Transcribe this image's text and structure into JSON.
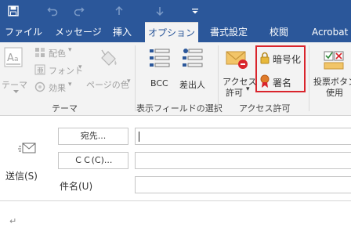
{
  "quick_access": {
    "save_icon": "save-icon",
    "undo_icon": "undo-icon",
    "redo_icon": "redo-icon",
    "up_icon": "up-arrow-icon",
    "down_icon": "down-arrow-icon",
    "customize_icon": "customize-icon"
  },
  "tabs": [
    {
      "label": "ファイル"
    },
    {
      "label": "メッセージ"
    },
    {
      "label": "挿入"
    },
    {
      "label": "オプション"
    },
    {
      "label": "書式設定"
    },
    {
      "label": "校閲"
    },
    {
      "label": "Acrobat"
    }
  ],
  "active_tab": "オプション",
  "ribbon": {
    "theme_group": {
      "theme_label": "テーマ",
      "colors_label": "配色",
      "fonts_label": "フォント",
      "effects_label": "効果",
      "page_color_label": "ページの色",
      "group_label": "テーマ"
    },
    "fields_group": {
      "bcc_label": "BCC",
      "from_label": "差出人",
      "group_label": "表示フィールドの選択"
    },
    "permission_group": {
      "permission_label_1": "アクセス",
      "permission_label_2": "許可",
      "encrypt_label": "暗号化",
      "sign_label": "署名",
      "group_label": "アクセス許可"
    },
    "tracking_group": {
      "voting_label_1": "投票ボタン",
      "voting_label_2": "使用"
    }
  },
  "colors": {
    "brand": "#2b579a",
    "highlight_box": "#d9242c"
  },
  "compose": {
    "send_label": "送信(S)",
    "to_button": "宛先...",
    "cc_button": "ＣＣ(C)...",
    "subject_label": "件名(U)",
    "to_value": "",
    "cc_value": "",
    "subject_value": "",
    "body_mark": "↵"
  }
}
